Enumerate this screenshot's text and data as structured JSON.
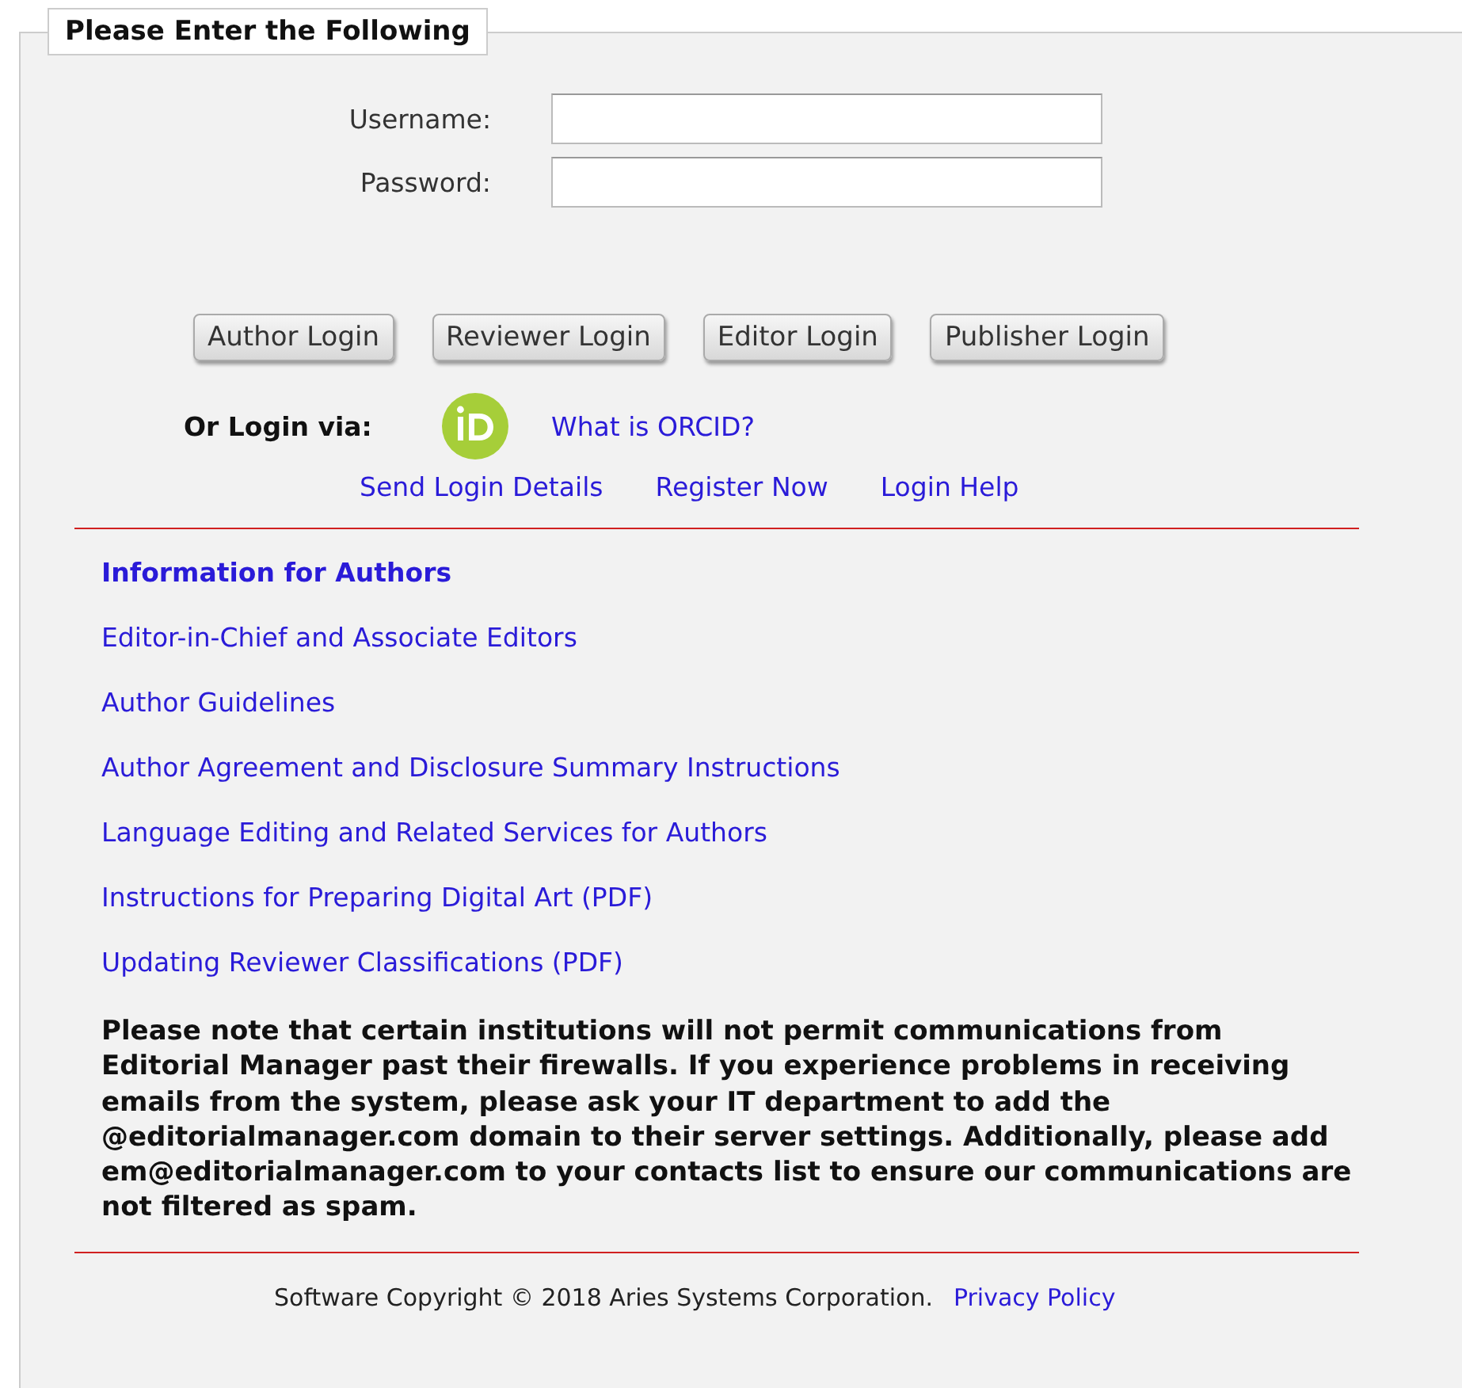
{
  "legend": "Please Enter the Following",
  "fields": [
    {
      "label": "Username:"
    },
    {
      "label": "Password:"
    }
  ],
  "buttons": [
    "Author Login",
    "Reviewer Login",
    "Editor Login",
    "Publisher Login"
  ],
  "orcid": {
    "label": "Or Login via:",
    "link": "What is ORCID?"
  },
  "login_links": [
    "Send Login Details",
    "Register Now",
    "Login Help"
  ],
  "info": {
    "heading": "Information for Authors",
    "links": [
      "Editor-in-Chief and Associate Editors",
      "Author Guidelines",
      "Author Agreement and Disclosure Summary Instructions",
      "Language Editing and Related Services for Authors",
      "Instructions for Preparing Digital Art (PDF)",
      "Updating Reviewer Classifications (PDF)"
    ]
  },
  "notice": "Please note that certain institutions will not permit communications from Editorial Manager past their firewalls. If you experience problems in receiving emails from the system, please ask your IT department to add the @editorialmanager.com domain to their server settings. Additionally, please add em@editorialmanager.com to your contacts list to ensure our communications are not filtered as spam.",
  "footer": {
    "copyright": "Software Copyright © 2018 Aries Systems Corporation.",
    "link": "Privacy Policy"
  }
}
